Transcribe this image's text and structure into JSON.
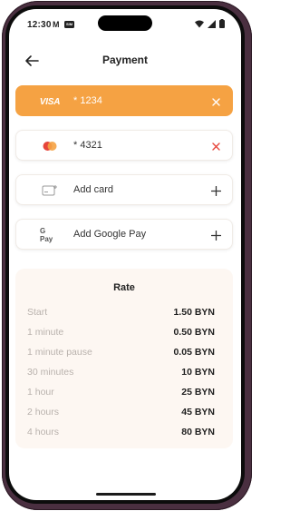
{
  "status": {
    "time": "12:30",
    "m_icon": "M",
    "sim_badge": "SIM"
  },
  "header": {
    "title": "Payment"
  },
  "methods": [
    {
      "brand": "VISA",
      "label": "* 1234",
      "icon": "visa-logo",
      "action": "close",
      "selected": true
    },
    {
      "brand": "Mastercard",
      "label": "* 4321",
      "icon": "mastercard-logo",
      "action": "close",
      "selected": false
    },
    {
      "brand": "",
      "label": "Add card",
      "icon": "card-add",
      "action": "plus",
      "selected": false
    },
    {
      "brand": "G Pay",
      "label": "Add Google Pay",
      "icon": "google-pay-logo",
      "action": "plus",
      "selected": false
    }
  ],
  "rate": {
    "title": "Rate",
    "rows": [
      {
        "label": "Start",
        "value": "1.50 BYN"
      },
      {
        "label": "1 minute",
        "value": "0.50 BYN"
      },
      {
        "label": "1 minute pause",
        "value": "0.05 BYN"
      },
      {
        "label": "30 minutes",
        "value": "10 BYN"
      },
      {
        "label": "1 hour",
        "value": "25 BYN"
      },
      {
        "label": "2 hours",
        "value": "45 BYN"
      },
      {
        "label": "4 hours",
        "value": "80 BYN"
      }
    ]
  },
  "colors": {
    "accent": "#f5a243",
    "close_red": "#e6453a",
    "panel_bg": "#fdf7f2",
    "frame": "#4a2f40"
  }
}
